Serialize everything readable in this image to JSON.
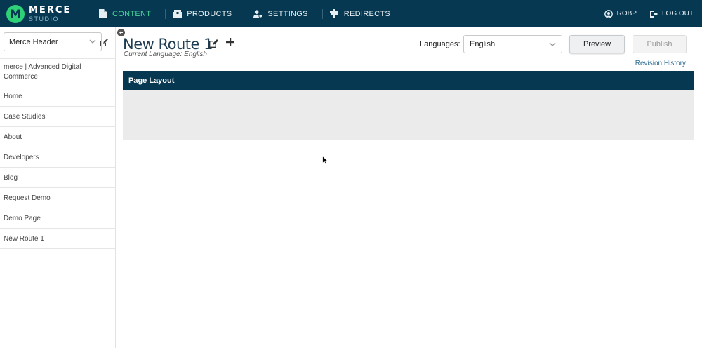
{
  "brand": {
    "name": "MERCE",
    "sub": "STUDIO",
    "mark": "M",
    "color": "#2fd178"
  },
  "nav": [
    {
      "label": "CONTENT",
      "icon": "document-icon",
      "active": true
    },
    {
      "label": "PRODUCTS",
      "icon": "box-icon",
      "active": false
    },
    {
      "label": "SETTINGS",
      "icon": "users-gear-icon",
      "active": false
    },
    {
      "label": "REDIRECTS",
      "icon": "signpost-icon",
      "active": false
    }
  ],
  "user": {
    "name": "ROBP",
    "logout": "LOG OUT"
  },
  "sidebar": {
    "site_value": "Merce Header",
    "items": [
      "merce | Advanced Digital Commerce",
      "Home",
      "Case Studies",
      "About",
      "Developers",
      "Blog",
      "Request Demo",
      "Demo Page",
      "New Route 1"
    ]
  },
  "page": {
    "title": "New Route 1",
    "current_language": "Current Language: English",
    "languages_label": "Languages:",
    "language_value": "English",
    "preview_label": "Preview",
    "publish_label": "Publish",
    "revision_history": "Revision History",
    "layout_title": "Page Layout"
  },
  "colors": {
    "header": "#063852",
    "active": "#48d49a",
    "link": "#2f6e94"
  }
}
